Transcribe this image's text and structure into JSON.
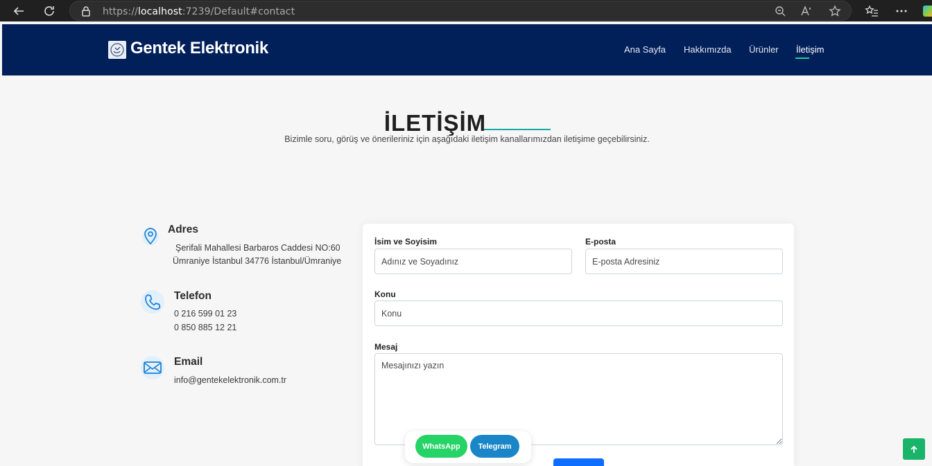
{
  "browser": {
    "url_scheme": "https://",
    "url_host": "localhost",
    "url_rest": ":7239/Default#contact"
  },
  "navbar": {
    "brand": "Gentek Elektronik",
    "items": [
      {
        "label": "Ana Sayfa"
      },
      {
        "label": "Hakkımızda"
      },
      {
        "label": "Ürünler"
      },
      {
        "label": "İletişim"
      }
    ],
    "active_index": 3,
    "accent_color": "#18d2a0",
    "background_color": "#01205a"
  },
  "section": {
    "title": "İLETİŞİM",
    "description": "Bizimle soru, görüş ve önerileriniz için aşağıdaki iletişim kanallarımızdan iletişime geçebilirsiniz."
  },
  "contact_info": {
    "address": {
      "title": "Adres",
      "icon": "map-pin-icon",
      "lines": [
        "Şerifali Mahallesi Barbaros Caddesi NO:60",
        "Ümraniye İstanbul 34776 İstanbul/Ümraniye"
      ]
    },
    "phone": {
      "title": "Telefon",
      "icon": "phone-icon",
      "lines": [
        "0 216 599 01 23",
        "0 850 885 12 21"
      ]
    },
    "email": {
      "title": "Email",
      "icon": "envelope-icon",
      "lines": [
        "info@gentekelektronik.com.tr"
      ]
    }
  },
  "form": {
    "name_label": "İsim ve Soyisim",
    "name_placeholder": "Adınız ve Soyadınız",
    "email_label": "E-posta",
    "email_placeholder": "E-posta Adresiniz",
    "subject_label": "Konu",
    "subject_placeholder": "Konu",
    "message_label": "Mesaj",
    "message_placeholder": "Mesajınızı yazın"
  },
  "floating": {
    "whatsapp_label": "WhatsApp",
    "telegram_label": "Telegram",
    "whatsapp_color": "#25d366",
    "telegram_color": "#1a86c8"
  },
  "scroll_top": {
    "icon": "arrow-up-icon",
    "color": "#19b46a"
  }
}
